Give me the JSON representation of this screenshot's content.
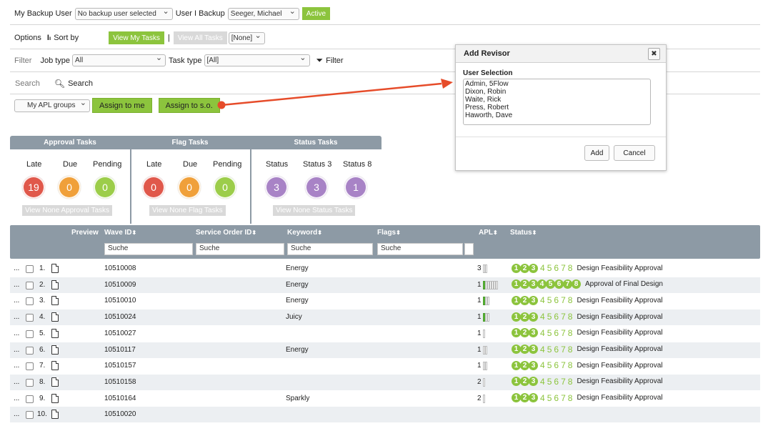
{
  "backup": {
    "my_backup_label": "My Backup User",
    "my_backup_value": "No backup user selected",
    "i_backup_label": "User I Backup",
    "i_backup_value": "Seeger, Michael",
    "active_label": "Active"
  },
  "options": {
    "options_label": "Options",
    "sort_by_label": "Sort by",
    "view_my_tasks": "View My Tasks",
    "separator": "|",
    "view_all_tasks": "View All Tasks",
    "none_select": "[None]"
  },
  "filter": {
    "filter_label": "Filter",
    "job_type_label": "Job type",
    "job_type_value": "All",
    "task_type_label": "Task type",
    "task_type_value": "[All]",
    "filter_button": "Filter"
  },
  "search": {
    "search_label": "Search",
    "search_link": "Search"
  },
  "assign": {
    "apl_groups": "My APL groups",
    "assign_to_me": "Assign to me",
    "assign_to_so": "Assign to s.o."
  },
  "panels": {
    "approval": {
      "title": "Approval Tasks",
      "late": "Late",
      "due": "Due",
      "pending": "Pending",
      "late_count": "19",
      "due_count": "0",
      "pending_count": "0",
      "view_none": "View None Approval Tasks"
    },
    "flag": {
      "title": "Flag Tasks",
      "late": "Late",
      "due": "Due",
      "pending": "Pending",
      "late_count": "0",
      "due_count": "0",
      "pending_count": "0",
      "view_none": "View None Flag Tasks"
    },
    "status": {
      "title": "Status Tasks",
      "s1": "Status",
      "s2": "Status 3",
      "s3": "Status 8",
      "s1_count": "3",
      "s2_count": "3",
      "s3_count": "1",
      "view_none": "View None Status Tasks"
    }
  },
  "colors": {
    "late": "#e0584b",
    "due": "#f0a03a",
    "pending": "#9ccd4a",
    "status": "#a883c6",
    "accent_green": "#8cc43d",
    "header_grey": "#8d9aa5"
  },
  "table": {
    "headers": {
      "preview": "Preview",
      "wave_id": "Wave ID",
      "service_order_id": "Service Order ID",
      "keyword": "Keyword",
      "flags": "Flags",
      "apl": "APL",
      "status": "Status"
    },
    "search_placeholder": "Suche",
    "rows": [
      {
        "num": "1.",
        "wave": "10510008",
        "keyword": "Energy",
        "apl": "3",
        "bars": [
          0,
          0
        ],
        "filled": 3,
        "plain": [
          "4",
          "5",
          "6",
          "7",
          "8"
        ],
        "status": "Design Feasibility Approval"
      },
      {
        "num": "2.",
        "wave": "10510009",
        "keyword": "Energy",
        "apl": "1",
        "bars": [
          1,
          0,
          0,
          0,
          0,
          0,
          0
        ],
        "filled": 8,
        "plain": [],
        "status": "Approval of Final Design"
      },
      {
        "num": "3.",
        "wave": "10510010",
        "keyword": "Energy",
        "apl": "1",
        "bars": [
          1,
          0,
          0
        ],
        "filled": 3,
        "plain": [
          "4",
          "5",
          "6",
          "7",
          "8"
        ],
        "status": "Design Feasibility Approval"
      },
      {
        "num": "4.",
        "wave": "10510024",
        "keyword": "Juicy",
        "apl": "1",
        "bars": [
          1,
          0,
          0
        ],
        "filled": 3,
        "plain": [
          "4",
          "5",
          "6",
          "7",
          "8"
        ],
        "status": "Design Feasibility Approval"
      },
      {
        "num": "5.",
        "wave": "10510027",
        "keyword": "",
        "apl": "1",
        "bars": [
          0
        ],
        "filled": 3,
        "plain": [
          "4",
          "5",
          "6",
          "7",
          "8"
        ],
        "status": "Design Feasibility Approval"
      },
      {
        "num": "6.",
        "wave": "10510117",
        "keyword": "Energy",
        "apl": "1",
        "bars": [
          0,
          0
        ],
        "filled": 3,
        "plain": [
          "4",
          "5",
          "6",
          "7",
          "8"
        ],
        "status": "Design Feasibility Approval"
      },
      {
        "num": "7.",
        "wave": "10510157",
        "keyword": "",
        "apl": "1",
        "bars": [
          0,
          0
        ],
        "filled": 3,
        "plain": [
          "4",
          "5",
          "6",
          "7",
          "8"
        ],
        "status": "Design Feasibility Approval"
      },
      {
        "num": "8.",
        "wave": "10510158",
        "keyword": "",
        "apl": "2",
        "bars": [
          0
        ],
        "filled": 3,
        "plain": [
          "4",
          "5",
          "6",
          "7",
          "8"
        ],
        "status": "Design Feasibility Approval"
      },
      {
        "num": "9.",
        "wave": "10510164",
        "keyword": "Sparkly",
        "apl": "2",
        "bars": [
          0
        ],
        "filled": 3,
        "plain": [
          "4",
          "5",
          "6",
          "7",
          "8"
        ],
        "status": "Design Feasibility Approval"
      },
      {
        "num": "10.",
        "wave": "10510020",
        "keyword": "",
        "apl": "",
        "bars": [],
        "filled": 0,
        "plain": [],
        "status": ""
      }
    ]
  },
  "dialog": {
    "title": "Add Revisor",
    "close": "✖",
    "section_label": "User Selection",
    "users": [
      "Admin, 5Flow",
      "Dixon, Robin",
      "Waite, Rick",
      "Press, Robert",
      "Haworth, Dave"
    ],
    "add": "Add",
    "cancel": "Cancel"
  }
}
